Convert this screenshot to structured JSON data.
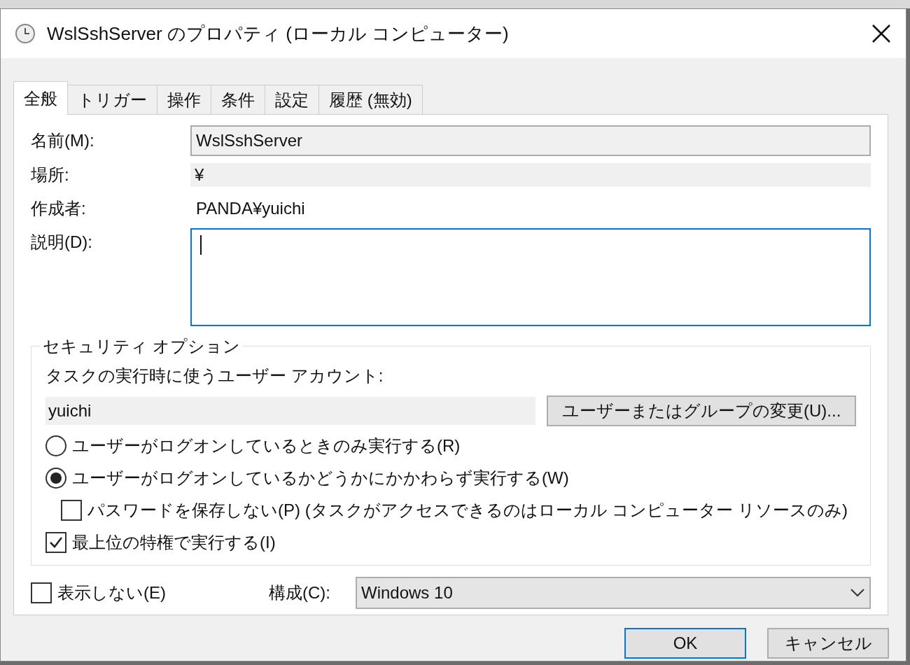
{
  "window": {
    "title": "WslSshServer のプロパティ (ローカル コンピューター)"
  },
  "tabs": [
    {
      "label": "全般",
      "selected": true
    },
    {
      "label": "トリガー",
      "selected": false
    },
    {
      "label": "操作",
      "selected": false
    },
    {
      "label": "条件",
      "selected": false
    },
    {
      "label": "設定",
      "selected": false
    },
    {
      "label": "履歴 (無効)",
      "selected": false
    }
  ],
  "general": {
    "name": {
      "label": "名前(M):",
      "value": "WslSshServer"
    },
    "location": {
      "label": "場所:",
      "value": "¥"
    },
    "author": {
      "label": "作成者:",
      "value": "PANDA¥yuichi"
    },
    "description": {
      "label": "説明(D):",
      "focused": true
    }
  },
  "security": {
    "title": "セキュリティ オプション",
    "account_label": "タスクの実行時に使うユーザー アカウント:",
    "account_value": "yuichi",
    "change_button": "ユーザーまたはグループの変更(U)...",
    "options": [
      {
        "kind": "radio",
        "label": "ユーザーがログオンしているときのみ実行する(R)",
        "selected": false
      },
      {
        "kind": "radio",
        "label": "ユーザーがログオンしているかどうかにかかわらず実行する(W)",
        "selected": true,
        "children": [
          {
            "kind": "checkbox",
            "label": "パスワードを保存しない(P) (タスクがアクセスできるのはローカル コンピューター リソースのみ)",
            "checked": false
          }
        ]
      },
      {
        "kind": "checkbox",
        "label": "最上位の特権で実行する(I)",
        "checked": true
      }
    ]
  },
  "hidden": {
    "label": "表示しない(E)",
    "checked": false
  },
  "configure": {
    "label": "構成(C):",
    "value": "Windows 10"
  },
  "buttons": [
    {
      "label": "OK",
      "default": true
    },
    {
      "label": "キャンセル",
      "default": false
    }
  ]
}
